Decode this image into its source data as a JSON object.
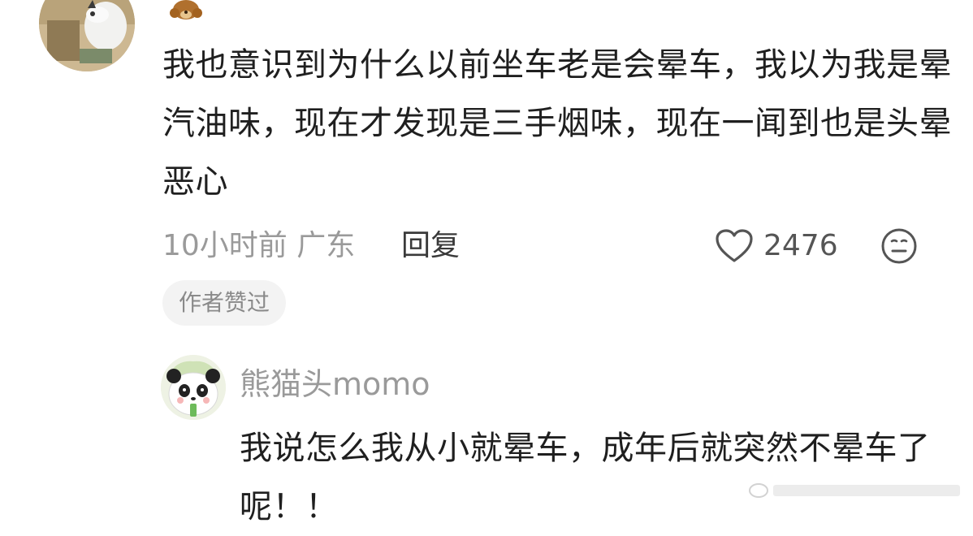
{
  "comment": {
    "text": "我也意识到为什么以前坐车老是会晕车，我以为我是晕汽油味，现在才发现是三手烟味，现在一闻到也是头晕恶心",
    "time_location": "10小时前 广东",
    "reply_label": "回复",
    "like_count": "2476",
    "author_liked_label": "作者赞过",
    "icons": {
      "like": "heart-outline-icon",
      "react": "neutral-face-icon",
      "badge": "bear-badge-icon"
    }
  },
  "reply": {
    "username": "熊猫头momo",
    "text": "我说怎么我从小就晕车，成年后就突然不晕车了呢！！"
  },
  "colors": {
    "text_primary": "#1f1f1f",
    "text_secondary": "#9a9a9a",
    "chip_bg": "#f3f3f3"
  }
}
